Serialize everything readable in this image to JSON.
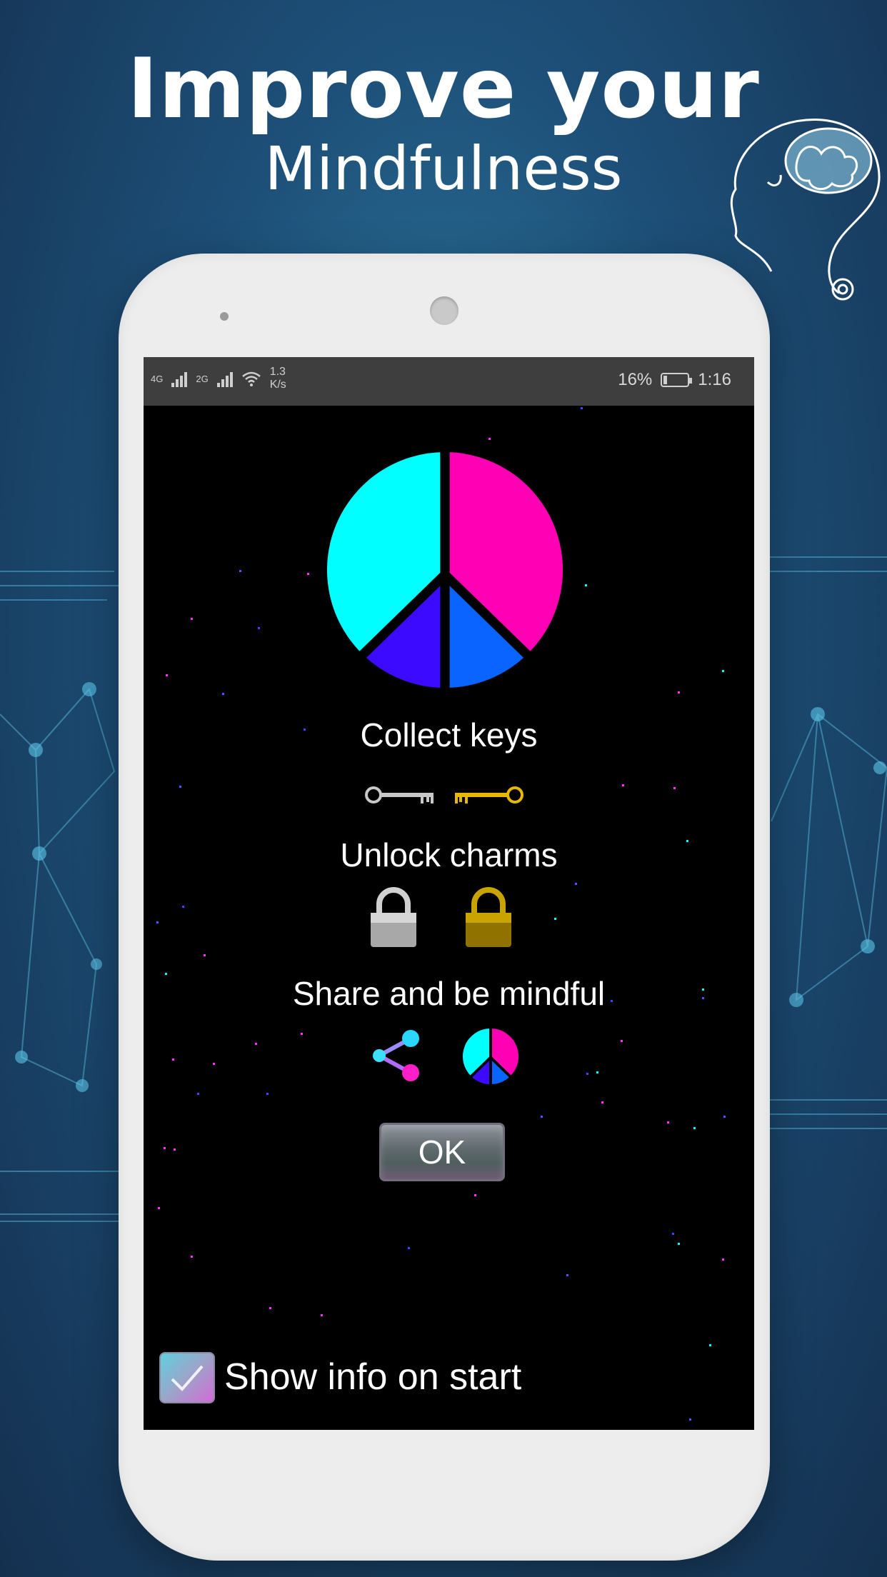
{
  "promo": {
    "headline": "Improve your",
    "subheadline": "Mindfulness"
  },
  "status_bar": {
    "network_1": "4G",
    "network_2": "2G",
    "speed_value": "1.3",
    "speed_unit": "K/s",
    "battery_percent": "16%",
    "battery_level": 0.16,
    "time": "1:16"
  },
  "info_dialog": {
    "collect_label": "Collect keys",
    "unlock_label": "Unlock charms",
    "share_label": "Share and be mindful",
    "ok_label": "OK",
    "show_info_label": "Show info on start",
    "show_info_checked": true
  },
  "icons": {
    "peace": "peace-sign-icon",
    "silver_key": "silver-key-icon",
    "gold_key": "gold-key-icon",
    "silver_lock": "silver-lock-icon",
    "gold_lock": "gold-lock-icon",
    "share": "share-icon",
    "head": "brain-head-icon"
  },
  "colors": {
    "peace_cyan": "#00ffff",
    "peace_magenta": "#ff00b4",
    "peace_indigo": "#3c0aff",
    "peace_blue": "#0a64ff",
    "background_blue": "#1d4f78"
  }
}
